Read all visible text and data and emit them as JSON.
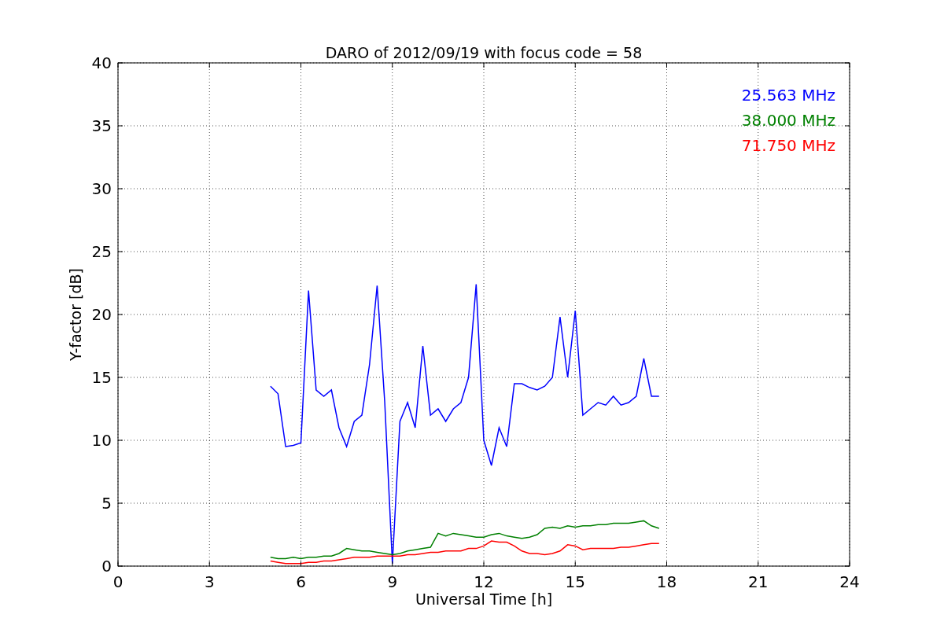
{
  "chart_data": {
    "type": "line",
    "grid": true,
    "title": "DARO of 2012/09/19 with focus code = 58",
    "xlabel": "Universal Time [h]",
    "ylabel": "Y-factor [dB]",
    "xlim": [
      0,
      24
    ],
    "ylim": [
      0,
      40
    ],
    "xticks": [
      0,
      3,
      6,
      9,
      12,
      15,
      18,
      21,
      24
    ],
    "yticks": [
      0,
      5,
      10,
      15,
      20,
      25,
      30,
      35,
      40
    ],
    "x": [
      5,
      5.25,
      5.5,
      5.75,
      6,
      6.25,
      6.5,
      6.75,
      7,
      7.25,
      7.5,
      7.75,
      8,
      8.25,
      8.5,
      8.75,
      9,
      9.25,
      9.5,
      9.75,
      10,
      10.25,
      10.5,
      10.75,
      11,
      11.25,
      11.5,
      11.75,
      12,
      12.25,
      12.5,
      12.75,
      13,
      13.25,
      13.5,
      13.75,
      14,
      14.25,
      14.5,
      14.75,
      15,
      15.25,
      15.5,
      15.75,
      16,
      16.25,
      16.5,
      16.75,
      17,
      17.25,
      17.5,
      17.75
    ],
    "series": [
      {
        "name": "25.563 MHz",
        "color": "#0000ff",
        "values": [
          14.3,
          13.7,
          9.5,
          9.6,
          9.8,
          21.9,
          14,
          13.5,
          14,
          11,
          9.5,
          11.5,
          12,
          16,
          22.3,
          13,
          0.2,
          11.5,
          13,
          11,
          17.5,
          12,
          12.5,
          11.5,
          12.5,
          13,
          15,
          22.4,
          10,
          8,
          11,
          9.5,
          14.5,
          14.5,
          14.2,
          14,
          14.3,
          15,
          19.8,
          15,
          20.3,
          12,
          12.5,
          13,
          12.8,
          13.5,
          12.8,
          13,
          13.5,
          16.5,
          13.5,
          13.5
        ]
      },
      {
        "name": "38.000 MHz",
        "color": "#008000",
        "values": [
          0.7,
          0.6,
          0.6,
          0.7,
          0.6,
          0.7,
          0.7,
          0.8,
          0.8,
          1.0,
          1.4,
          1.3,
          1.2,
          1.2,
          1.1,
          1.0,
          0.9,
          1.0,
          1.2,
          1.3,
          1.4,
          1.5,
          2.6,
          2.4,
          2.6,
          2.5,
          2.4,
          2.3,
          2.3,
          2.5,
          2.6,
          2.4,
          2.3,
          2.2,
          2.3,
          2.5,
          3.0,
          3.1,
          3.0,
          3.2,
          3.1,
          3.2,
          3.2,
          3.3,
          3.3,
          3.4,
          3.4,
          3.4,
          3.5,
          3.6,
          3.2,
          3.0
        ]
      },
      {
        "name": "71.750 MHz",
        "color": "#ff0000",
        "values": [
          0.4,
          0.3,
          0.2,
          0.2,
          0.2,
          0.3,
          0.3,
          0.4,
          0.4,
          0.5,
          0.6,
          0.7,
          0.7,
          0.7,
          0.8,
          0.8,
          0.8,
          0.8,
          0.9,
          0.9,
          1.0,
          1.1,
          1.1,
          1.2,
          1.2,
          1.2,
          1.4,
          1.4,
          1.6,
          2.0,
          1.9,
          1.9,
          1.6,
          1.2,
          1.0,
          1.0,
          0.9,
          1.0,
          1.2,
          1.7,
          1.6,
          1.3,
          1.4,
          1.4,
          1.4,
          1.4,
          1.5,
          1.5,
          1.6,
          1.7,
          1.8,
          1.8
        ]
      }
    ]
  }
}
